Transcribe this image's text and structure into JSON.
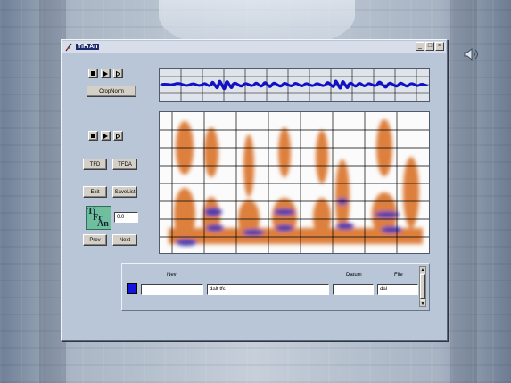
{
  "window": {
    "title": "TiFrAn",
    "controls": [
      "_",
      "□",
      "×"
    ]
  },
  "top_player": {
    "stop_icon": "stop-icon",
    "play_icon": "play-icon",
    "step_icon": "step-icon"
  },
  "crop_button": "CropNorm",
  "mid_player": {
    "stop_icon": "stop-icon",
    "play_icon": "play-icon",
    "step_icon": "step-icon"
  },
  "buttons": {
    "tfd": "TFD",
    "tfda": "TFDA",
    "exit": "Exit",
    "savelist": "SaveList",
    "prev": "Prev",
    "next": "Next"
  },
  "logo": {
    "t": "Ti",
    "f": "Fr",
    "a": "An"
  },
  "value_field": "0.0",
  "bottom": {
    "headers": {
      "name": "Nev",
      "date": "Datum",
      "file": "File"
    },
    "row": {
      "name": "-",
      "desc": "dalt tfs",
      "date": "",
      "file": "dal"
    },
    "swatch_color": "#1414e0"
  },
  "colors": {
    "waveform": "#1010c8",
    "spectrogram_energy": "#d86a1c",
    "spectrogram_formant": "#2a1aa0"
  },
  "desktop": {
    "speaker_icon": "speaker-icon"
  }
}
